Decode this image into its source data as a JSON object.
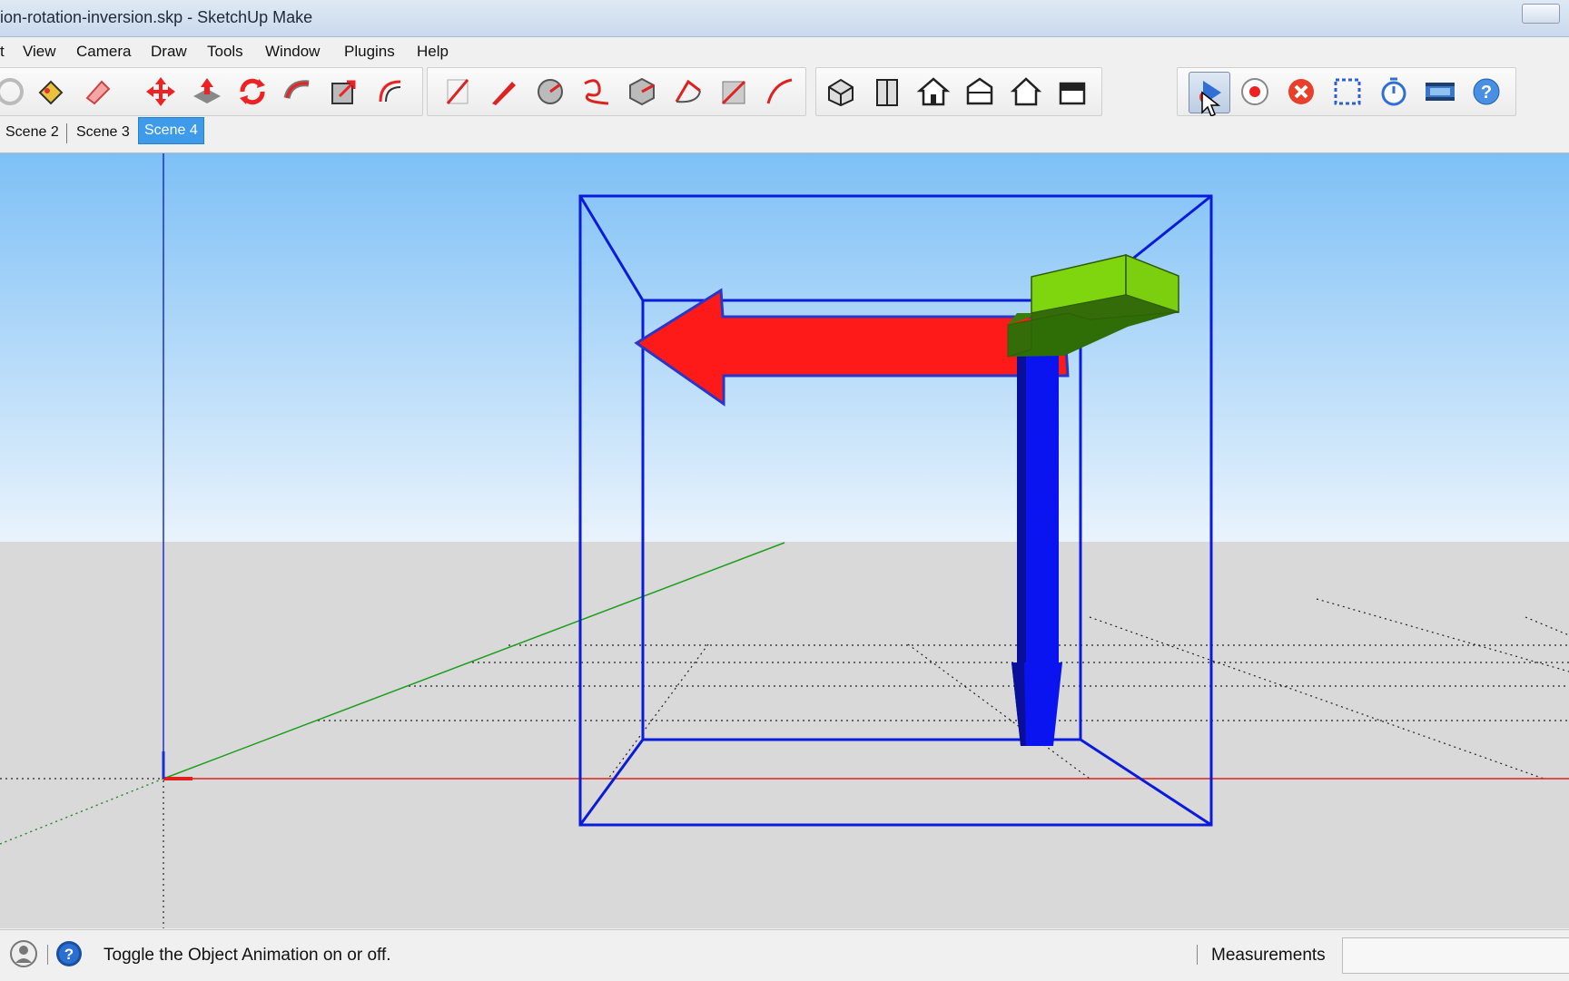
{
  "window": {
    "title": "ion-rotation-inversion.skp - SketchUp Make"
  },
  "menu": [
    "t",
    "View",
    "Camera",
    "Draw",
    "Tools",
    "Window",
    "Plugins",
    "Help"
  ],
  "toolbar": {
    "edit_tools": [
      "orbit-icon",
      "paint-bucket-icon",
      "eraser-icon",
      "move-icon",
      "push-pull-icon",
      "rotate-icon",
      "follow-me-icon",
      "scale-icon",
      "offset-icon"
    ],
    "draw_tools": [
      "line-icon",
      "pencil-icon",
      "circle-icon",
      "freehand-icon",
      "polygon-icon",
      "arc-icon",
      "two-point-arc-icon",
      "pie-icon"
    ],
    "view_tools": [
      "iso-view-icon",
      "front-view-icon",
      "top-view-icon",
      "back-view-icon",
      "left-view-icon",
      "right-view-icon"
    ],
    "animation_tools": [
      "play-icon",
      "record-icon",
      "stop-icon",
      "select-box-icon",
      "timer-icon",
      "film-icon",
      "help-icon"
    ]
  },
  "scenes": [
    {
      "label": "Scene 2",
      "selected": false
    },
    {
      "label": "Scene 3",
      "selected": false
    },
    {
      "label": "Scene 4",
      "selected": true
    }
  ],
  "status": {
    "message": "Toggle the Object Animation on or off.",
    "measurements_label": "Measurements",
    "measurements_value": ""
  },
  "colors": {
    "sky_top": "#7ec0f6",
    "sky_bottom": "#e9f3fc",
    "ground": "#d9d9d9",
    "box": "#0a1bdc",
    "red_arrow": "#ff1a1a",
    "green_arrow": "#7fd60e",
    "blue_arrow": "#0a14f0",
    "selected_tab": "#3d9be9"
  }
}
